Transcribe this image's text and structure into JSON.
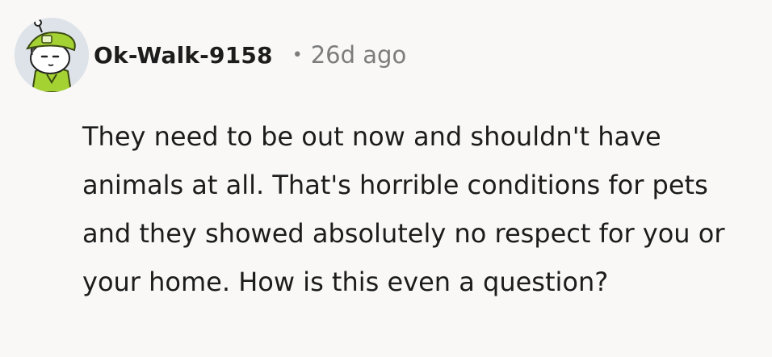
{
  "comment": {
    "author": "Ok-Walk-9158",
    "separator": "•",
    "timestamp": "26d ago",
    "avatar_icon": "snoo-avatar-lime-hat",
    "body": "They need to be out now and shouldn't have animals at all. That's horrible conditions for pets and they showed absolutely no respect for you or your home. How is this even a question?"
  },
  "colors": {
    "background": "#f9f8f7",
    "text": "#1c1c1c",
    "meta": "#7c7c7c",
    "avatar_accent": "#a4d233"
  }
}
